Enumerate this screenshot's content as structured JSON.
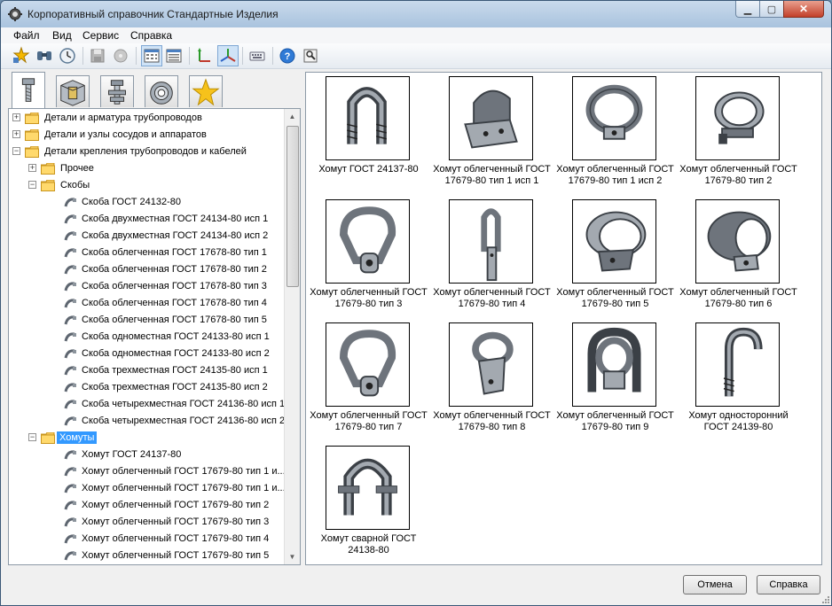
{
  "window": {
    "title": "Корпоративный справочник Стандартные Изделия"
  },
  "menu": [
    "Файл",
    "Вид",
    "Сервис",
    "Справка"
  ],
  "toolbar": [
    {
      "name": "add-star-icon",
      "active": false
    },
    {
      "name": "binoculars-icon",
      "active": false
    },
    {
      "name": "clock-icon",
      "active": false
    },
    {
      "name": "sep"
    },
    {
      "name": "save-icon",
      "active": false
    },
    {
      "name": "disk-icon",
      "active": false
    },
    {
      "name": "sep"
    },
    {
      "name": "grid-view-icon",
      "active": true
    },
    {
      "name": "list-view-icon",
      "active": false
    },
    {
      "name": "sep"
    },
    {
      "name": "axes-2d-icon",
      "active": false
    },
    {
      "name": "axes-3d-icon",
      "active": true
    },
    {
      "name": "sep"
    },
    {
      "name": "keyboard-icon",
      "active": false
    },
    {
      "name": "sep"
    },
    {
      "name": "help-icon",
      "active": false
    },
    {
      "name": "info-icon",
      "active": false
    }
  ],
  "tabs": [
    {
      "name": "bolt-tab-icon",
      "active": true
    },
    {
      "name": "part-tab-icon",
      "active": false
    },
    {
      "name": "assembly-tab-icon",
      "active": false
    },
    {
      "name": "gear-tab-icon",
      "active": false
    },
    {
      "name": "favorites-star-icon",
      "active": false
    }
  ],
  "tree": [
    {
      "level": 0,
      "type": "folder",
      "exp": "+",
      "label": "Детали и арматура трубопроводов"
    },
    {
      "level": 0,
      "type": "folder",
      "exp": "+",
      "label": "Детали и узлы сосудов и аппаратов"
    },
    {
      "level": 0,
      "type": "folder",
      "exp": "-",
      "label": "Детали крепления трубопроводов и кабелей"
    },
    {
      "level": 1,
      "type": "folder",
      "exp": "+",
      "label": "Прочее"
    },
    {
      "level": 1,
      "type": "folder",
      "exp": "-",
      "label": "Скобы"
    },
    {
      "level": 2,
      "type": "leaf",
      "label": "Скоба ГОСТ 24132-80"
    },
    {
      "level": 2,
      "type": "leaf",
      "label": "Скоба двухместная ГОСТ 24134-80 исп 1"
    },
    {
      "level": 2,
      "type": "leaf",
      "label": "Скоба двухместная ГОСТ 24134-80 исп 2"
    },
    {
      "level": 2,
      "type": "leaf",
      "label": "Скоба облегченная ГОСТ 17678-80 тип 1"
    },
    {
      "level": 2,
      "type": "leaf",
      "label": "Скоба облегченная ГОСТ 17678-80 тип 2"
    },
    {
      "level": 2,
      "type": "leaf",
      "label": "Скоба облегченная ГОСТ 17678-80 тип 3"
    },
    {
      "level": 2,
      "type": "leaf",
      "label": "Скоба облегченная ГОСТ 17678-80 тип 4"
    },
    {
      "level": 2,
      "type": "leaf",
      "label": "Скоба облегченная ГОСТ 17678-80 тип 5"
    },
    {
      "level": 2,
      "type": "leaf",
      "label": "Скоба одноместная ГОСТ 24133-80 исп 1"
    },
    {
      "level": 2,
      "type": "leaf",
      "label": "Скоба одноместная ГОСТ 24133-80 исп 2"
    },
    {
      "level": 2,
      "type": "leaf",
      "label": "Скоба трехместная ГОСТ 24135-80 исп 1"
    },
    {
      "level": 2,
      "type": "leaf",
      "label": "Скоба трехместная ГОСТ 24135-80 исп 2"
    },
    {
      "level": 2,
      "type": "leaf",
      "label": "Скоба четырехместная ГОСТ 24136-80 исп 1"
    },
    {
      "level": 2,
      "type": "leaf",
      "label": "Скоба четырехместная ГОСТ 24136-80 исп 2"
    },
    {
      "level": 1,
      "type": "folder",
      "exp": "-",
      "label": "Хомуты",
      "selected": true
    },
    {
      "level": 2,
      "type": "leaf",
      "label": "Хомут ГОСТ 24137-80"
    },
    {
      "level": 2,
      "type": "leaf",
      "label": "Хомут облегченный ГОСТ 17679-80 тип 1 и..."
    },
    {
      "level": 2,
      "type": "leaf",
      "label": "Хомут облегченный ГОСТ 17679-80 тип 1 и..."
    },
    {
      "level": 2,
      "type": "leaf",
      "label": "Хомут облегченный ГОСТ 17679-80 тип 2"
    },
    {
      "level": 2,
      "type": "leaf",
      "label": "Хомут облегченный ГОСТ 17679-80 тип 3"
    },
    {
      "level": 2,
      "type": "leaf",
      "label": "Хомут облегченный ГОСТ 17679-80 тип 4"
    },
    {
      "level": 2,
      "type": "leaf",
      "label": "Хомут облегченный ГОСТ 17679-80 тип 5"
    }
  ],
  "items": [
    {
      "shape": "ubolt",
      "label": "Хомут ГОСТ 24137-80"
    },
    {
      "shape": "clamp-flat",
      "label": "Хомут облегченный ГОСТ 17679-80 тип 1 исп 1"
    },
    {
      "shape": "clamp-ring",
      "label": "Хомут облегченный ГОСТ 17679-80 тип 1 исп 2"
    },
    {
      "shape": "clamp-bolt",
      "label": "Хомут облегченный ГОСТ 17679-80 тип 2"
    },
    {
      "shape": "clamp-tab",
      "label": "Хомут облегченный ГОСТ 17679-80 тип 3"
    },
    {
      "shape": "clamp-narrow",
      "label": "Хомут облегченный ГОСТ 17679-80 тип 4"
    },
    {
      "shape": "clamp-wide",
      "label": "Хомут облегченный ГОСТ 17679-80 тип 5"
    },
    {
      "shape": "clamp-tube",
      "label": "Хомут облегченный ГОСТ 17679-80 тип 6"
    },
    {
      "shape": "clamp-tab",
      "label": "Хомут облегченный ГОСТ 17679-80 тип 7"
    },
    {
      "shape": "clamp-narrow-tab",
      "label": "Хомут облегченный ГОСТ 17679-80 тип 8"
    },
    {
      "shape": "clamp-frame",
      "label": "Хомут облегченный ГОСТ 17679-80 тип 9"
    },
    {
      "shape": "hook",
      "label": "Хомут односторонний ГОСТ 24139-80"
    },
    {
      "shape": "welded",
      "label": "Хомут сварной ГОСТ 24138-80"
    }
  ],
  "buttons": {
    "cancel": "Отмена",
    "help": "Справка"
  }
}
